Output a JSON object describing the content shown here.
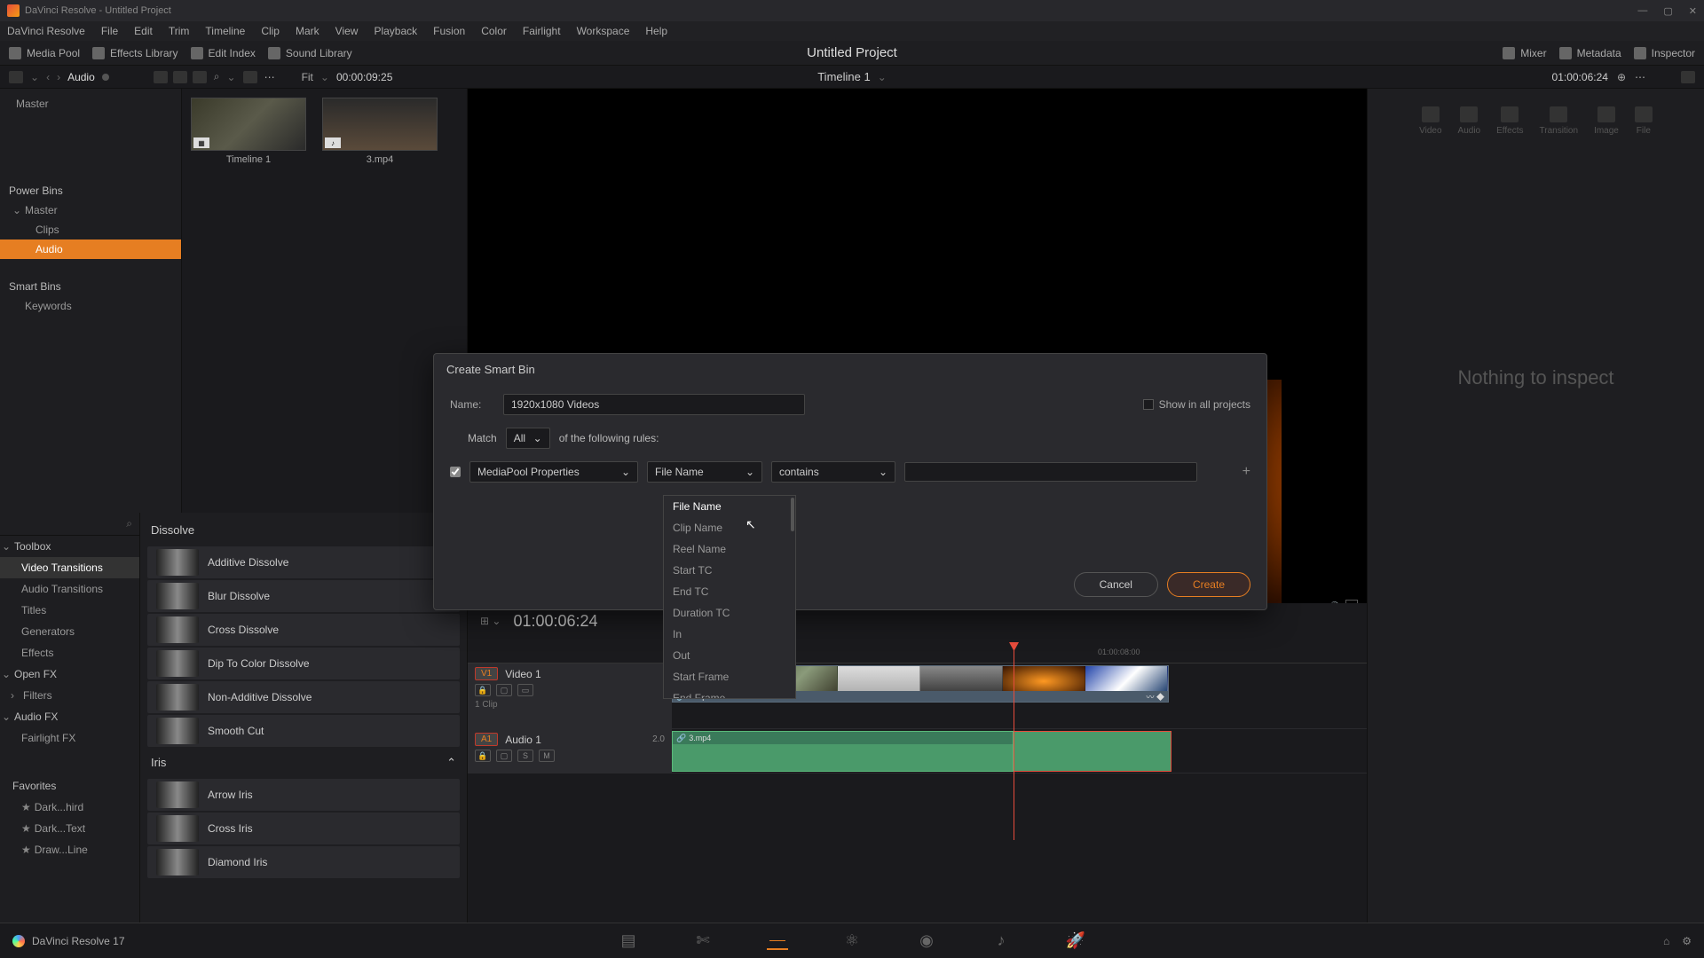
{
  "titlebar": {
    "text": "DaVinci Resolve - Untitled Project"
  },
  "menubar": [
    "DaVinci Resolve",
    "File",
    "Edit",
    "Trim",
    "Timeline",
    "Clip",
    "Mark",
    "View",
    "Playback",
    "Fusion",
    "Color",
    "Fairlight",
    "Workspace",
    "Help"
  ],
  "toolbar": {
    "media_pool": "Media Pool",
    "effects_library": "Effects Library",
    "edit_index": "Edit Index",
    "sound_library": "Sound Library",
    "mixer": "Mixer",
    "metadata": "Metadata",
    "inspector": "Inspector"
  },
  "project_title": "Untitled Project",
  "toolbar2": {
    "audio_label": "Audio",
    "fit": "Fit",
    "tc_left": "00:00:09:25",
    "timeline_name": "Timeline 1",
    "tc_right": "01:00:06:24"
  },
  "sidebar": {
    "master": "Master",
    "power_bins": "Power Bins",
    "pb_master": "Master",
    "clips": "Clips",
    "audio": "Audio",
    "smart_bins": "Smart Bins",
    "keywords": "Keywords"
  },
  "thumbs": [
    {
      "label": "Timeline 1",
      "badge": "▦"
    },
    {
      "label": "3.mp4",
      "badge": "♪"
    }
  ],
  "dialog": {
    "title": "Create Smart Bin",
    "name_label": "Name:",
    "name_value": "1920x1080 Videos",
    "show_all": "Show in all projects",
    "match": "Match",
    "match_val": "All",
    "rules_suffix": "of the following rules:",
    "prop_source": "MediaPool Properties",
    "field": "File Name",
    "condition": "contains",
    "cancel": "Cancel",
    "create": "Create"
  },
  "dropdown": [
    "File Name",
    "Clip Name",
    "Reel Name",
    "Start TC",
    "End TC",
    "Duration TC",
    "In",
    "Out",
    "Start Frame",
    "End Frame"
  ],
  "effects": {
    "sidebar": {
      "toolbox": "Toolbox",
      "video_transitions": "Video Transitions",
      "audio_transitions": "Audio Transitions",
      "titles": "Titles",
      "generators": "Generators",
      "effects": "Effects",
      "open_fx": "Open FX",
      "filters": "Filters",
      "audio_fx": "Audio FX",
      "fairlight_fx": "Fairlight FX",
      "favorites": "Favorites",
      "fav1": "Dark...hird",
      "fav2": "Dark...Text",
      "fav3": "Draw...Line"
    },
    "categories": {
      "dissolve": "Dissolve",
      "iris": "Iris"
    },
    "dissolve": [
      "Additive Dissolve",
      "Blur Dissolve",
      "Cross Dissolve",
      "Dip To Color Dissolve",
      "Non-Additive Dissolve",
      "Smooth Cut"
    ],
    "iris": [
      "Arrow Iris",
      "Cross Iris",
      "Diamond Iris"
    ]
  },
  "timeline": {
    "tc": "01:00:06:24",
    "ruler_label": "01:00:08:00",
    "video_track": "Video 1",
    "video_badge": "V1",
    "video_sub": "1 Clip",
    "audio_track": "Audio 1",
    "audio_badge": "A1",
    "audio_ch": "2.0",
    "clip_name": "3.mp4"
  },
  "inspector": {
    "tabs": [
      "Video",
      "Audio",
      "Effects",
      "Transition",
      "Image",
      "File"
    ],
    "msg": "Nothing to inspect"
  },
  "bottom": {
    "version": "DaVinci Resolve 17"
  }
}
